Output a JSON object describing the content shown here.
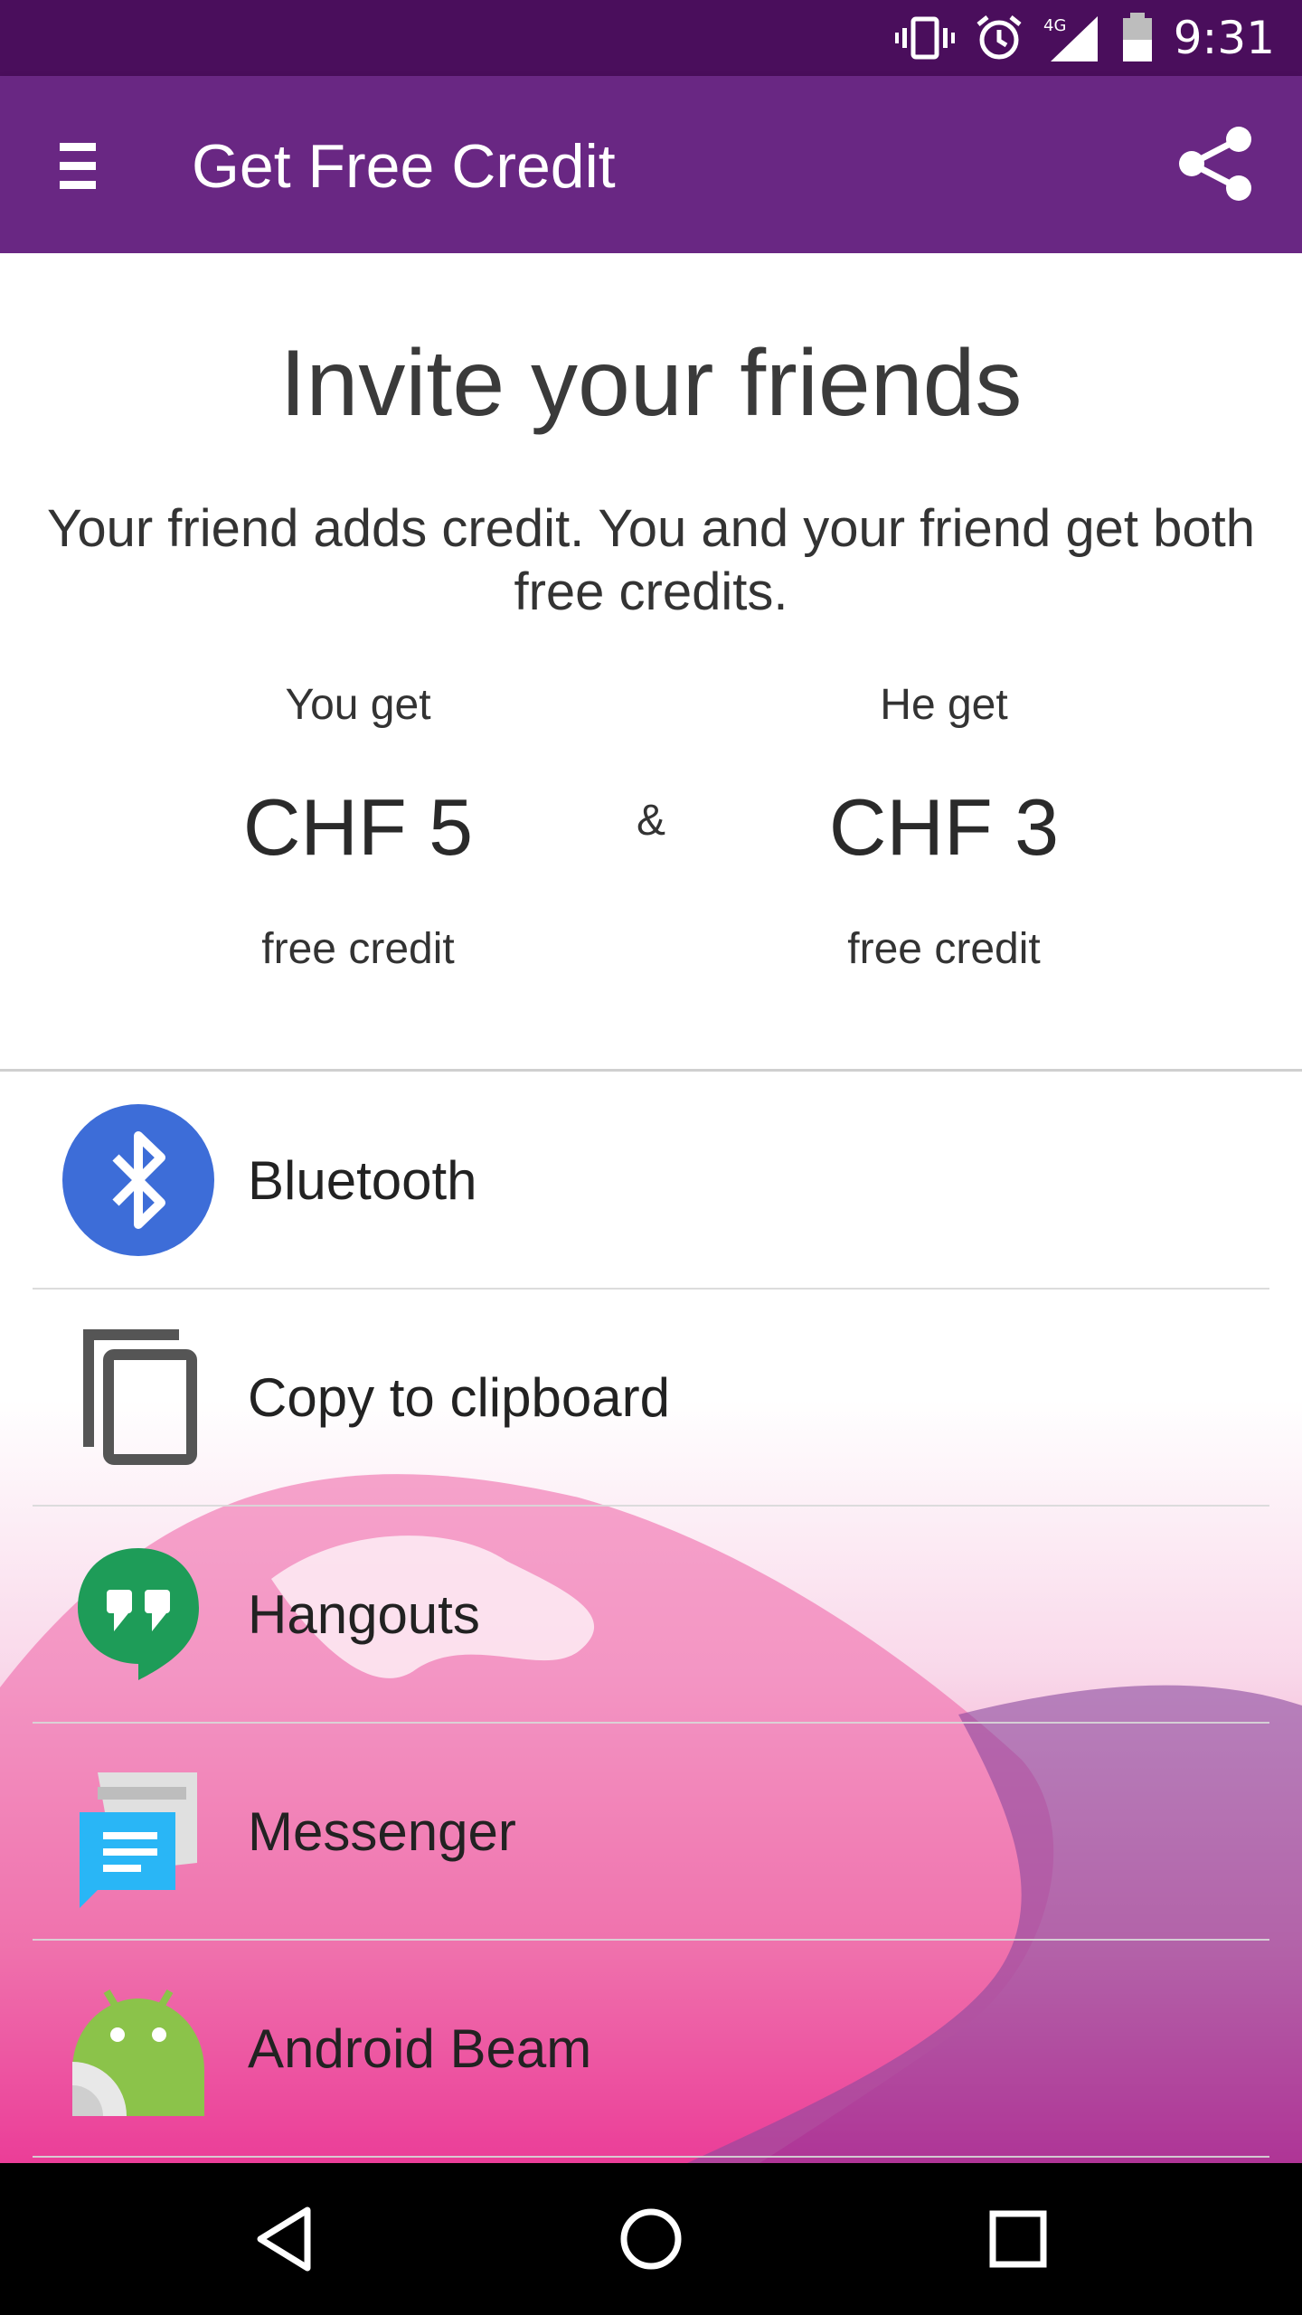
{
  "status_bar": {
    "time": "9:31",
    "network": "4G",
    "icons": [
      "vibrate-icon",
      "alarm-icon",
      "signal-4g-icon",
      "battery-icon"
    ]
  },
  "app_bar": {
    "title": "Get Free Credit",
    "menu_icon": "hamburger-menu-icon",
    "share_icon": "share-icon",
    "color": "#692783"
  },
  "invite": {
    "title": "Invite your friends",
    "description": "Your friend adds credit. You and your friend get both free credits.",
    "you": {
      "caption": "You get",
      "amount": "CHF 5",
      "sub": "free credit"
    },
    "separator": "&",
    "friend": {
      "caption": "He get",
      "amount": "CHF 3",
      "sub": "free credit"
    }
  },
  "share_targets": [
    {
      "label": "Bluetooth",
      "icon": "bluetooth-icon"
    },
    {
      "label": "Copy to clipboard",
      "icon": "clipboard-icon"
    },
    {
      "label": "Hangouts",
      "icon": "hangouts-icon"
    },
    {
      "label": "Messenger",
      "icon": "messenger-icon"
    },
    {
      "label": "Android Beam",
      "icon": "android-beam-icon"
    }
  ],
  "nav_bar": {
    "back_icon": "back-icon",
    "home_icon": "home-icon",
    "recents_icon": "recents-icon"
  }
}
